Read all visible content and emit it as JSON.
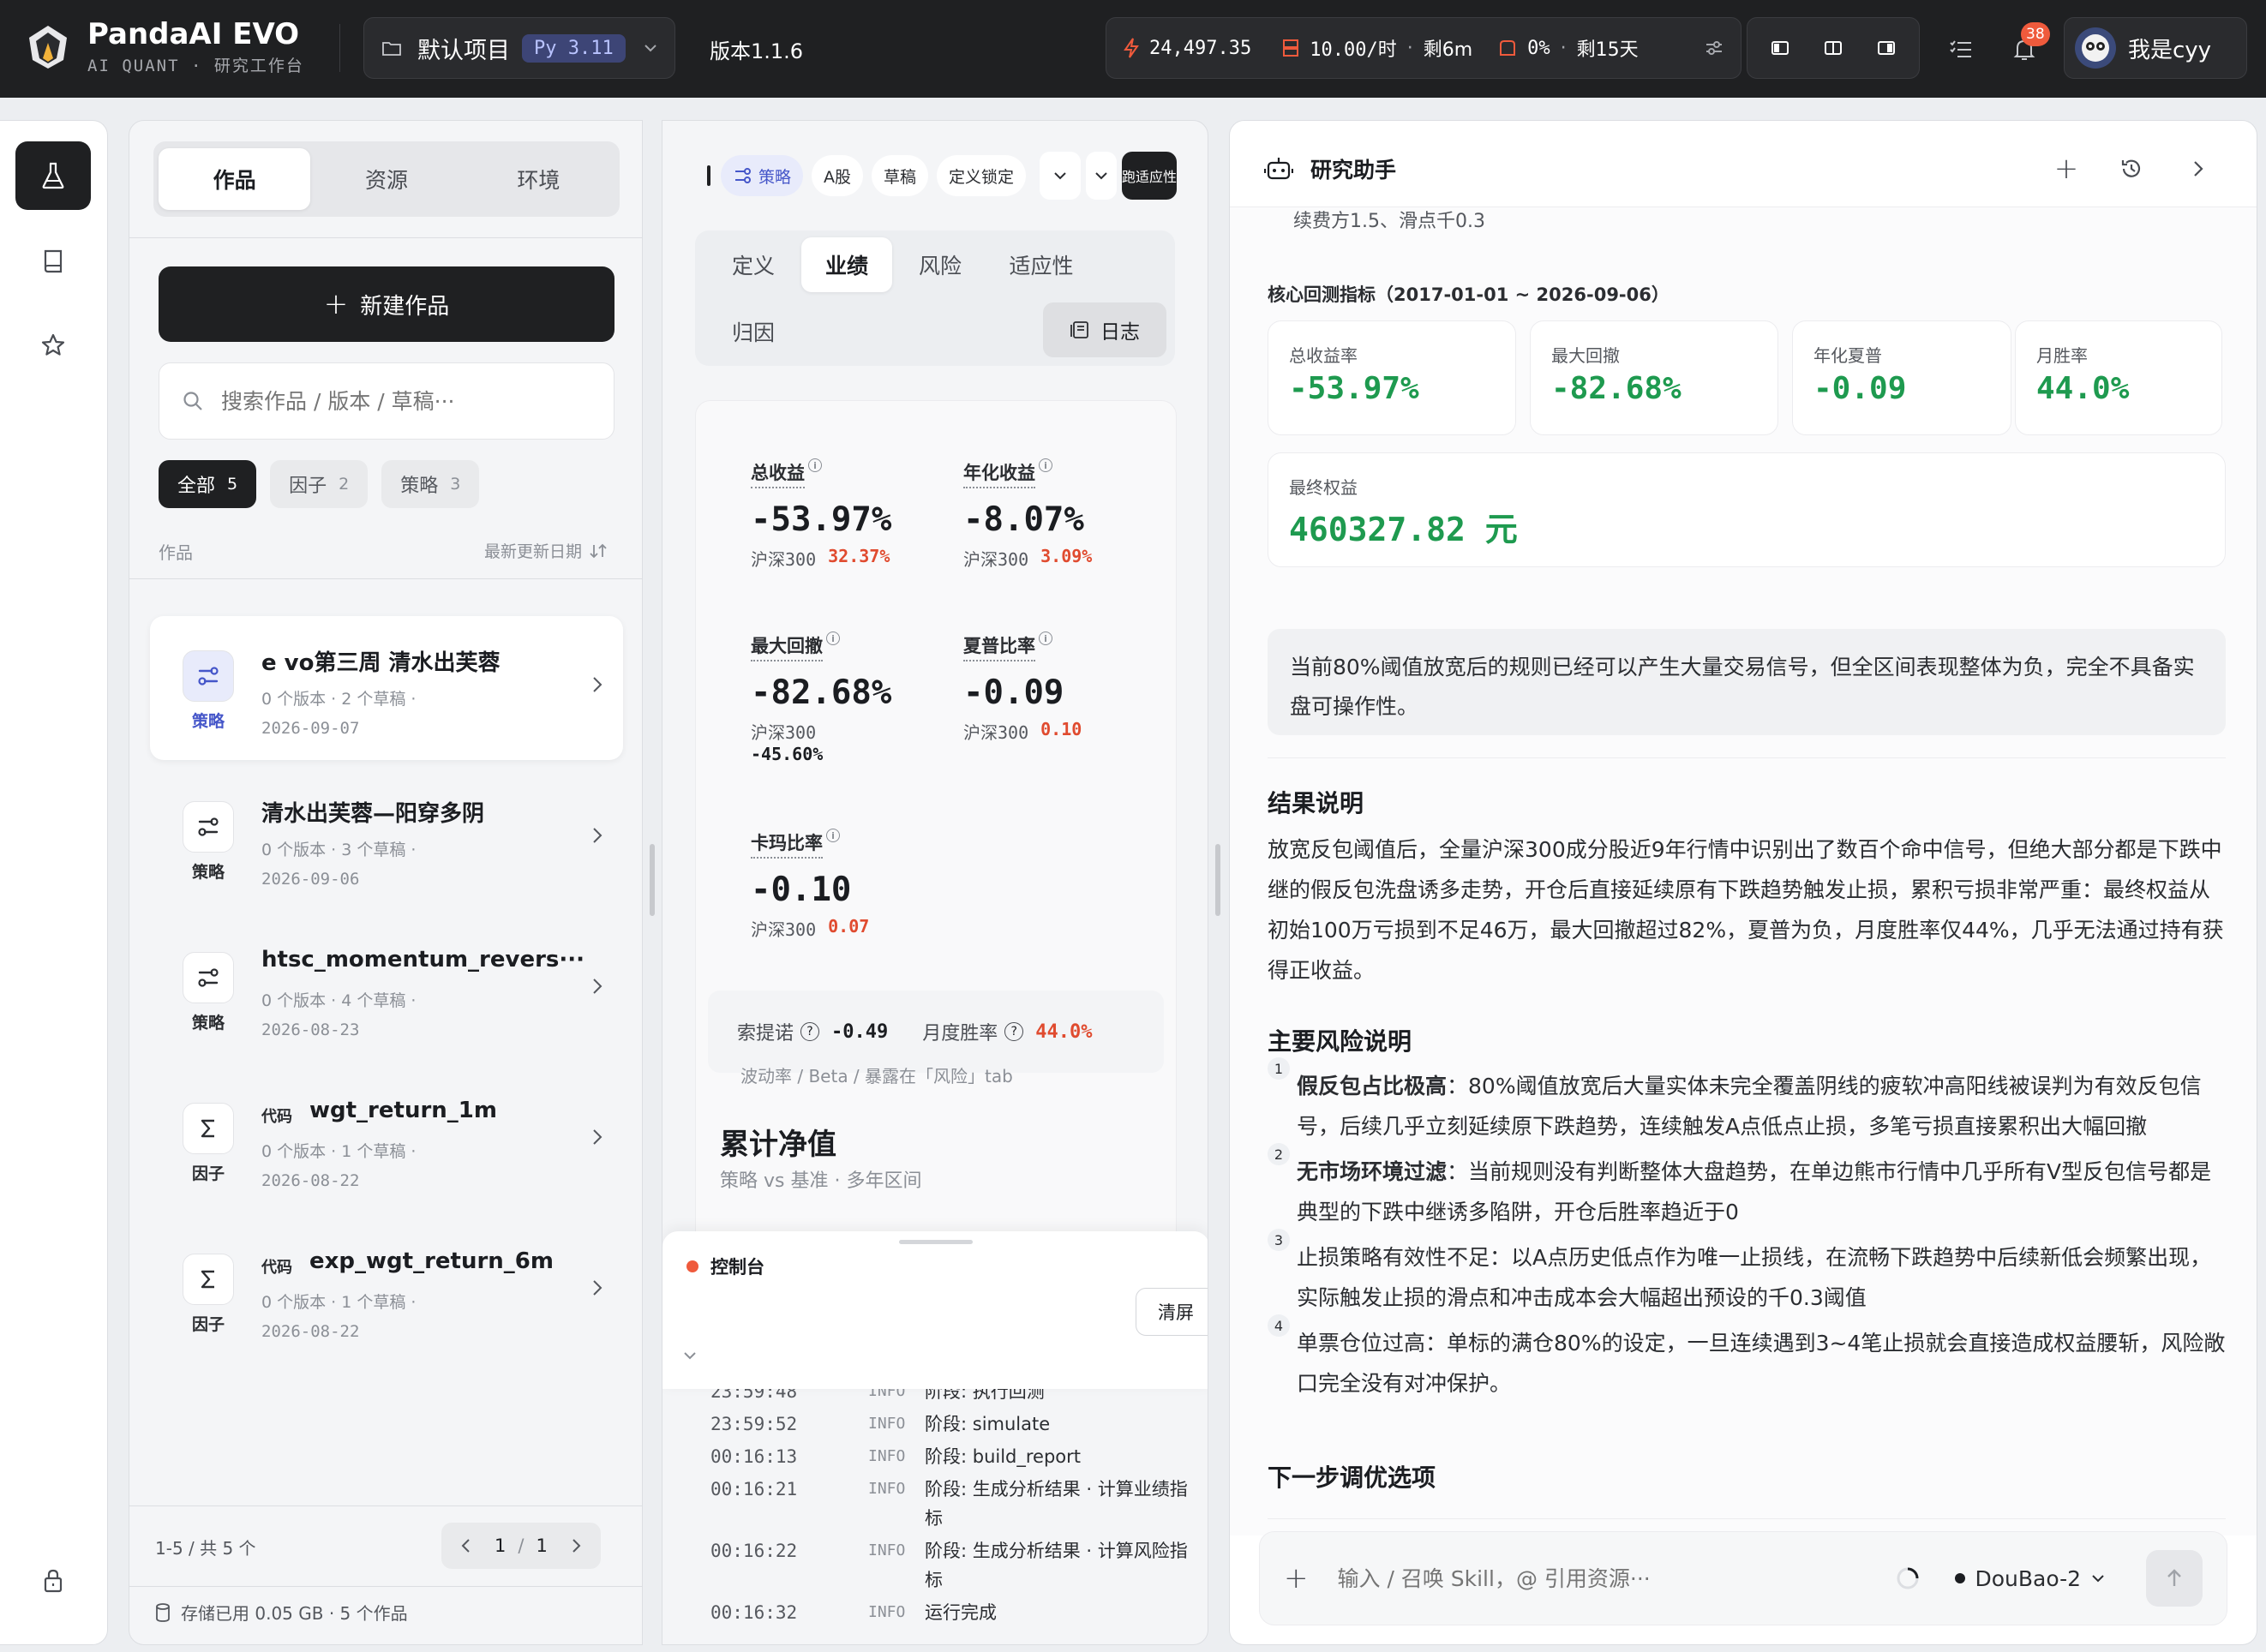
{
  "app": {
    "name": "PandaAI EVO",
    "subtitle": "AI QUANT · 研究工作台"
  },
  "project": {
    "name": "默认项目",
    "python": "Py 3.11"
  },
  "version": "版本1.1.6",
  "status": {
    "credits": "24,497.35",
    "rate": "10.00/时",
    "rate_remaining": "剩6m",
    "usage": "0%",
    "days": "剩15天"
  },
  "notifications": "38",
  "user": {
    "name": "我是cyy"
  },
  "colors": {
    "accent": "#1f2022",
    "green": "#1e9a4f",
    "red": "#e04b2f",
    "badge": "#ef5a3c"
  },
  "left": {
    "tabs": [
      {
        "label": "作品"
      },
      {
        "label": "资源"
      },
      {
        "label": "环境"
      }
    ],
    "new_button": "新建作品",
    "search_placeholder": "搜索作品 / 版本 / 草稿···",
    "filters": [
      {
        "label": "全部",
        "count": "5"
      },
      {
        "label": "因子",
        "count": "2"
      },
      {
        "label": "策略",
        "count": "3"
      }
    ],
    "list_header": "作品",
    "sort_label": "最新更新日期",
    "items": [
      {
        "title": "e vo第三周 清水出芙蓉",
        "prefix": "",
        "meta": "0 个版本 · 2 个草稿 ·",
        "date": "2026-09-07",
        "kind": "策略",
        "icon": "strategy-icon"
      },
      {
        "title": "清水出芙蓉—阳穿多阴",
        "prefix": "",
        "meta": "0 个版本 · 3 个草稿 ·",
        "date": "2026-09-06",
        "kind": "策略",
        "icon": "strategy-icon"
      },
      {
        "title": "htsc_momentum_revers···",
        "prefix": "",
        "meta": "0 个版本 · 4 个草稿 ·",
        "date": "2026-08-23",
        "kind": "策略",
        "icon": "strategy-icon"
      },
      {
        "title": "wgt_return_1m",
        "prefix": "代码",
        "meta": "0 个版本 · 1 个草稿 ·",
        "date": "2026-08-22",
        "kind": "因子",
        "icon": "sigma-icon"
      },
      {
        "title": "exp_wgt_return_6m",
        "prefix": "代码",
        "meta": "0 个版本 · 1 个草稿 ·",
        "date": "2026-08-22",
        "kind": "因子",
        "icon": "sigma-icon"
      }
    ],
    "pagination": {
      "summary": "1-5 / 共 5 个",
      "current": "1",
      "total": "1"
    },
    "storage": "存储已用 0.05 GB · 5 个作品"
  },
  "middle": {
    "header_tags": [
      "策略",
      "A股",
      "草稿",
      "定义锁定"
    ],
    "header_action": "跑适应性",
    "tabs": [
      "定义",
      "业绩",
      "风险",
      "适应性",
      "归因"
    ],
    "log_button": "日志",
    "metrics": [
      {
        "label": "总收益",
        "value": "-53.97%",
        "bench_label": "沪深300",
        "bench": "32.37%"
      },
      {
        "label": "年化收益",
        "value": "-8.07%",
        "bench_label": "沪深300",
        "bench": "3.09%"
      },
      {
        "label": "最大回撤",
        "value": "-82.68%",
        "bench_label": "沪深300",
        "bench": "-45.60%"
      },
      {
        "label": "夏普比率",
        "value": "-0.09",
        "bench_label": "沪深300",
        "bench": "0.10"
      },
      {
        "label": "卡玛比率",
        "value": "-0.10",
        "bench_label": "沪深300",
        "bench": "0.07"
      }
    ],
    "sortino": {
      "label": "索提诺",
      "value": "-0.49"
    },
    "monthly": {
      "label": "月度胜率",
      "value": "44.0%"
    },
    "note": "波动率 / Beta / 暴露在「风险」tab",
    "nav_title": "累计净值",
    "nav_sub": "策略 vs 基准 · 多年区间",
    "console": {
      "title": "控制台",
      "clear": "清屏",
      "logs": [
        {
          "time": "23:59:48",
          "level": "INFO",
          "msg": "阶段: 执行回测"
        },
        {
          "time": "23:59:52",
          "level": "INFO",
          "msg": "阶段: simulate"
        },
        {
          "time": "00:16:13",
          "level": "INFO",
          "msg": "阶段: build_report"
        },
        {
          "time": "00:16:21",
          "level": "INFO",
          "msg": "阶段: 生成分析结果 · 计算业绩指标"
        },
        {
          "time": "00:16:22",
          "level": "INFO",
          "msg": "阶段: 生成分析结果 · 计算风险指标"
        },
        {
          "time": "00:16:32",
          "level": "INFO",
          "msg": "运行完成"
        }
      ]
    }
  },
  "right": {
    "title": "研究助手",
    "cut_text": "续费方1.5、滑点千0.3",
    "metrics_heading": "核心回测指标（2017-01-01 ~ 2026-09-06）",
    "metrics": [
      {
        "label": "总收益率",
        "value": "-53.97%"
      },
      {
        "label": "最大回撤",
        "value": "-82.68%"
      },
      {
        "label": "年化夏普",
        "value": "-0.09"
      },
      {
        "label": "月胜率",
        "value": "44.0%"
      }
    ],
    "final": {
      "label": "最终权益",
      "value": "460327.82 元"
    },
    "callout": "当前80%阈值放宽后的规则已经可以产生大量交易信号，但全区间表现整体为负，完全不具备实盘可操作性。",
    "result_heading": "结果说明",
    "result_text": "放宽反包阈值后，全量沪深300成分股近9年行情中识别出了数百个命中信号，但绝大部分都是下跌中继的假反包洗盘诱多走势，开仓后直接延续原有下跌趋势触发止损，累积亏损非常严重：最终权益从初始100万亏损到不足46万，最大回撤超过82%，夏普为负，月度胜率仅44%，几乎无法通过持有获得正收益。",
    "risk_heading": "主要风险说明",
    "risks": [
      {
        "n": "1",
        "bold": "假反包占比极高",
        "text": "：80%阈值放宽后大量实体未完全覆盖阴线的疲软冲高阳线被误判为有效反包信号，后续几乎立刻延续原下跌趋势，连续触发A点低点止损，多笔亏损直接累积出大幅回撤"
      },
      {
        "n": "2",
        "bold": "无市场环境过滤",
        "text": "：当前规则没有判断整体大盘趋势，在单边熊市行情中几乎所有V型反包信号都是典型的下跌中继诱多陷阱，开仓后胜率趋近于0"
      },
      {
        "n": "3",
        "bold": "",
        "text": "止损策略有效性不足：以A点历史低点作为唯一止损线，在流畅下跌趋势中后续新低会频繁出现，实际触发止损的滑点和冲击成本会大幅超出预设的千0.3阈值"
      },
      {
        "n": "4",
        "bold": "",
        "text": "单票仓位过高：单标的满仓80%的设定，一旦连续遇到3~4笔止损就会直接造成权益腰斩，风险敞口完全没有对冲保护。"
      }
    ],
    "next_heading": "下一步调优选项",
    "input_placeholder": "输入 / 召唤 Skill，@ 引用资源···",
    "model": "DouBao-2"
  }
}
